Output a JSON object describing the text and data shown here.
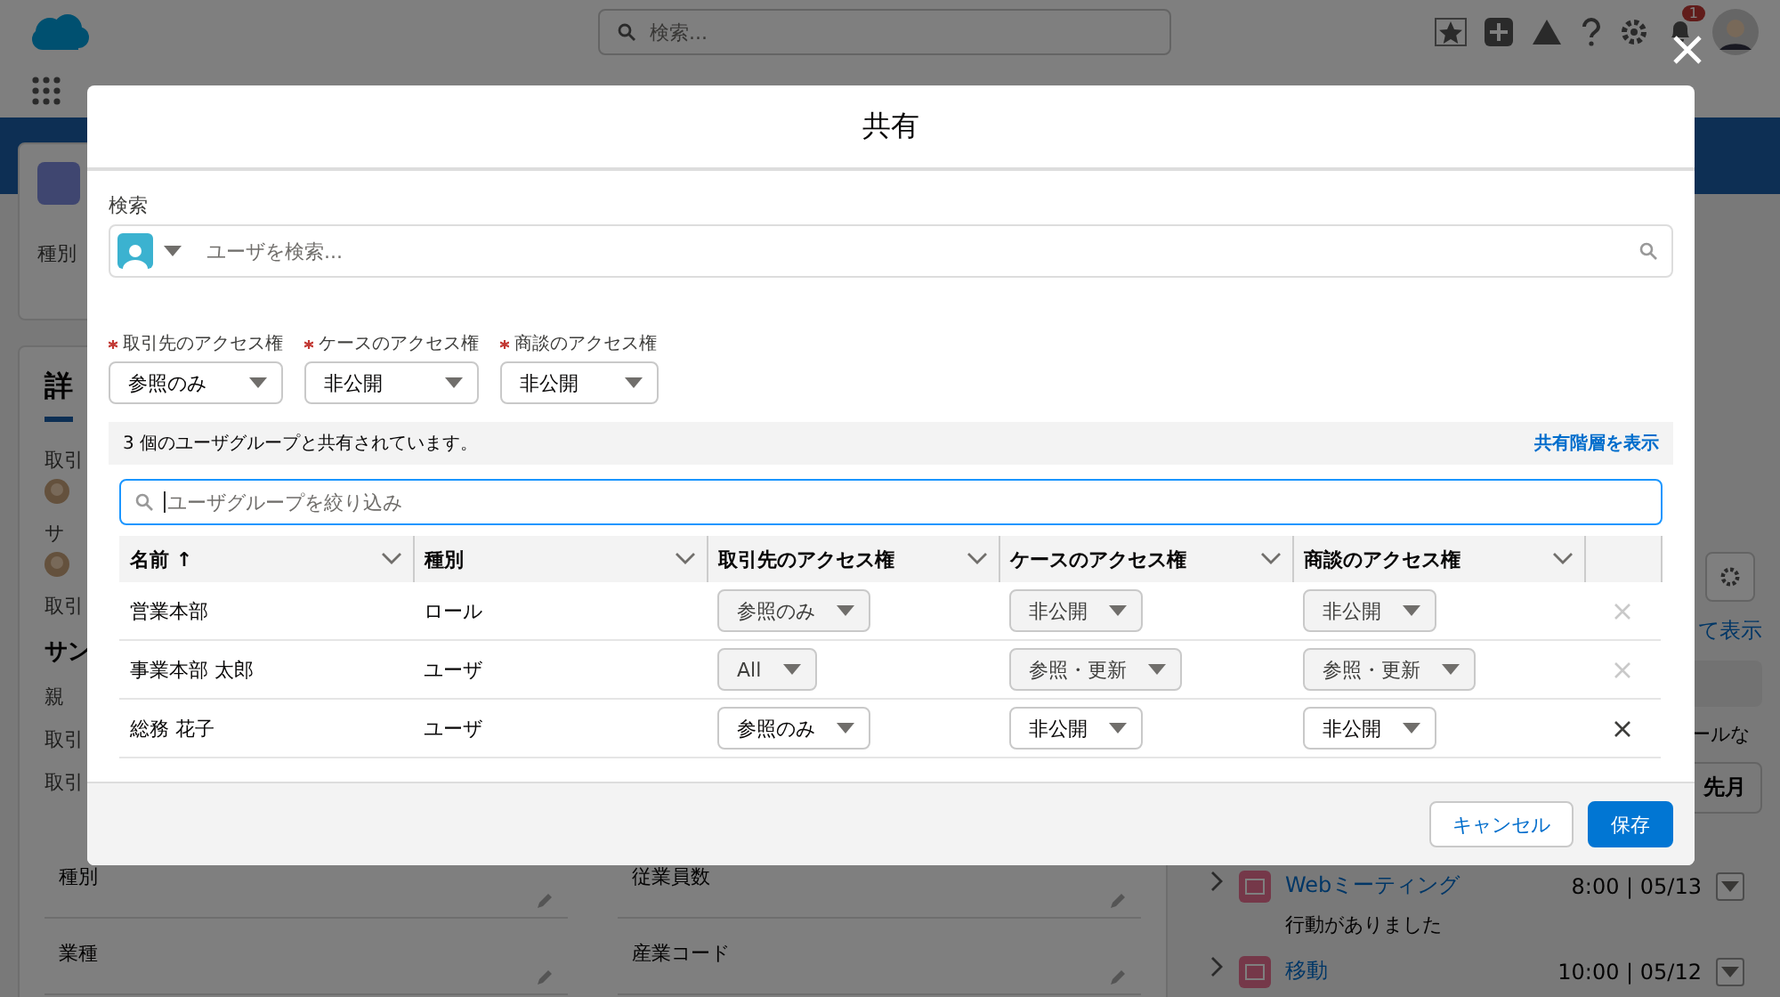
{
  "app_header": {
    "search_placeholder": "検索...",
    "notification_count": "1"
  },
  "background": {
    "record_field_label": "種別",
    "detail_tab": "詳",
    "side_labels": [
      {
        "text": "取引",
        "avatar": true
      },
      {
        "text": "サ",
        "avatar": true
      },
      {
        "text": "取引",
        "avatar": false
      },
      {
        "text": "サン",
        "avatar": false
      },
      {
        "text": "親",
        "avatar": false
      },
      {
        "text": "取引",
        "avatar": false
      },
      {
        "text": "取引",
        "avatar": false
      }
    ],
    "fields": [
      {
        "label": "種別"
      },
      {
        "label": "従業員数"
      },
      {
        "label": "業種"
      },
      {
        "label": "産業コード"
      }
    ],
    "right": {
      "link": "て表示",
      "text": "ールな",
      "month_button": "先月",
      "timeline": [
        {
          "title": "Webミーティング",
          "time": "8:00 | 05/13",
          "note": "行動がありました"
        },
        {
          "title": "移動",
          "time": "10:00 | 05/12"
        }
      ]
    }
  },
  "modal": {
    "title": "共有",
    "search_label": "検索",
    "search_placeholder": "ユーザを検索...",
    "default_access": [
      {
        "label": "取引先のアクセス権",
        "value": "参照のみ",
        "required": true
      },
      {
        "label": "ケースのアクセス権",
        "value": "非公開",
        "required": true
      },
      {
        "label": "商談のアクセス権",
        "value": "非公開",
        "required": true
      }
    ],
    "shared_summary": "3 個のユーザグループと共有されています。",
    "hierarchy_link": "共有階層を表示",
    "filter_placeholder": "ユーザグループを絞り込み",
    "table": {
      "columns": [
        {
          "label": "名前 ↑"
        },
        {
          "label": "種別"
        },
        {
          "label": "取引先のアクセス権"
        },
        {
          "label": "ケースのアクセス権"
        },
        {
          "label": "商談のアクセス権"
        }
      ],
      "rows": [
        {
          "name": "営業本部",
          "type": "ロール",
          "account_access": "参照のみ",
          "case_access": "非公開",
          "opportunity_access": "非公開",
          "disabled": true
        },
        {
          "name": "事業本部 太郎",
          "type": "ユーザ",
          "account_access": "All",
          "case_access": "参照・更新",
          "opportunity_access": "参照・更新",
          "disabled": true
        },
        {
          "name": "総務 花子",
          "type": "ユーザ",
          "account_access": "参照のみ",
          "case_access": "非公開",
          "opportunity_access": "非公開",
          "disabled": false
        }
      ]
    },
    "buttons": [
      {
        "label": "キャンセル",
        "kind": "neutral"
      },
      {
        "label": "保存",
        "kind": "brand"
      }
    ]
  }
}
